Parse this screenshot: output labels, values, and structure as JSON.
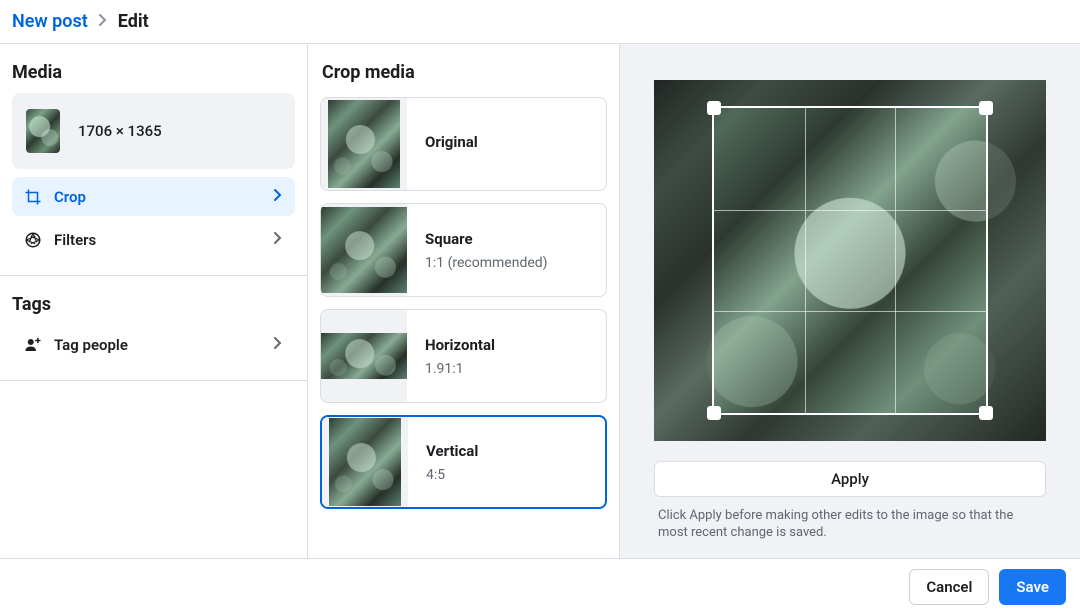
{
  "breadcrumb": {
    "root": "New post",
    "current": "Edit"
  },
  "sidebar": {
    "heading_media": "Media",
    "image_dimensions": "1706 × 1365",
    "items": [
      {
        "id": "crop",
        "label": "Crop",
        "icon": "crop-icon",
        "active": true
      },
      {
        "id": "filters",
        "label": "Filters",
        "icon": "aperture-icon",
        "active": false
      }
    ],
    "heading_tags": "Tags",
    "tag_items": [
      {
        "id": "tag-people",
        "label": "Tag people",
        "icon": "tag-person-icon"
      }
    ]
  },
  "crop": {
    "heading": "Crop media",
    "options": [
      {
        "id": "original",
        "title": "Original",
        "subtitle": "",
        "selected": false
      },
      {
        "id": "square",
        "title": "Square",
        "subtitle": "1:1 (recommended)",
        "selected": false
      },
      {
        "id": "horizontal",
        "title": "Horizontal",
        "subtitle": "1.91:1",
        "selected": false
      },
      {
        "id": "vertical",
        "title": "Vertical",
        "subtitle": "4:5",
        "selected": true
      }
    ]
  },
  "preview": {
    "apply_label": "Apply",
    "hint": "Click Apply before making other edits to the image so that the most recent change is saved."
  },
  "footer": {
    "cancel": "Cancel",
    "save": "Save"
  }
}
